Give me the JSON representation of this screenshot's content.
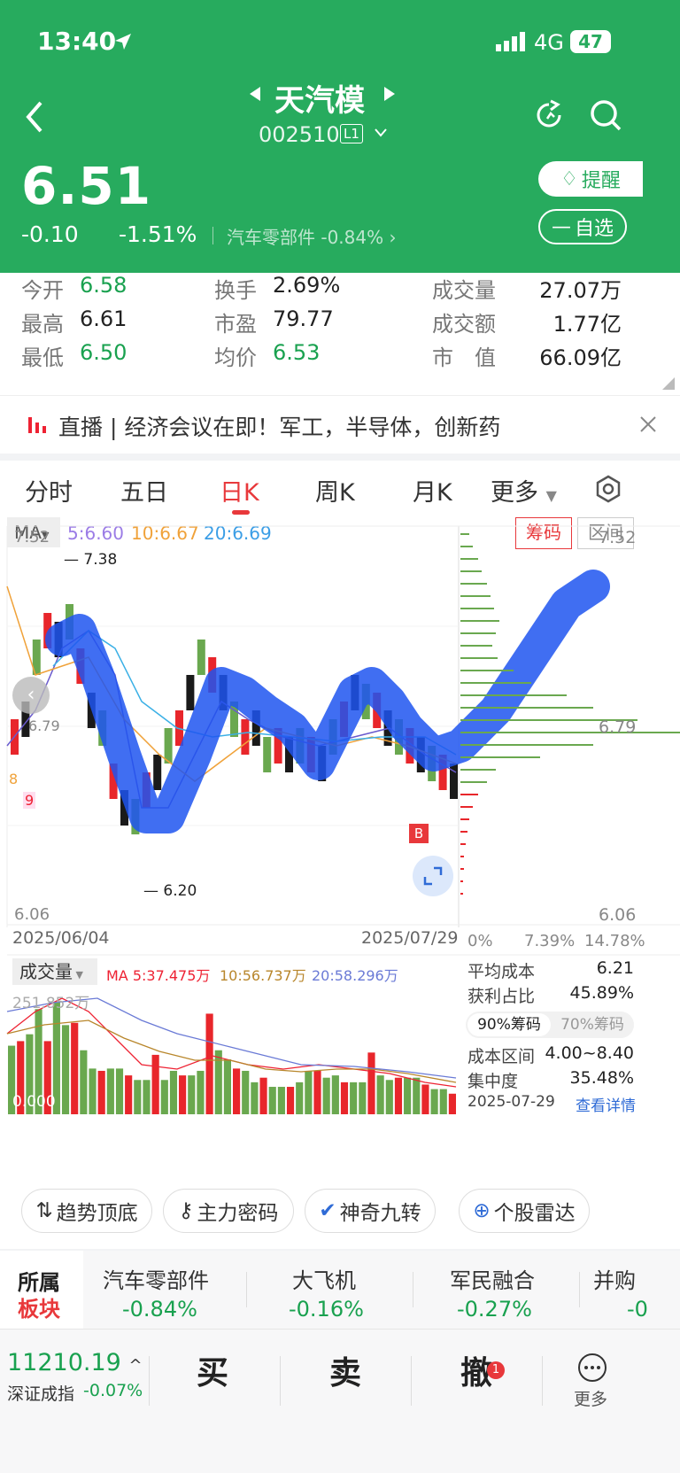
{
  "status": {
    "time": "13:40",
    "network": "4G",
    "battery": "47"
  },
  "stock": {
    "name": "天汽模",
    "code": "002510",
    "level": "L1",
    "price": "6.51",
    "change": "-0.10",
    "change_pct": "-1.51%",
    "sector": "汽车零部件",
    "sector_pct": "-0.84%",
    "remind": "提醒",
    "watch": "自选"
  },
  "stats": [
    {
      "label": "今开",
      "value": "6.58"
    },
    {
      "label": "换手",
      "value": "2.69%"
    },
    {
      "label": "成交量",
      "value": "27.07万"
    },
    {
      "label": "最高",
      "value": "6.61"
    },
    {
      "label": "市盈",
      "value": "79.77"
    },
    {
      "label": "成交额",
      "value": "1.77亿"
    },
    {
      "label": "最低",
      "value": "6.50"
    },
    {
      "label": "均价",
      "value": "6.53"
    },
    {
      "label": "市　值",
      "value": "66.09亿"
    }
  ],
  "news": {
    "tag": "直播",
    "text": "经济会议在即！军工，半导体，创新药"
  },
  "tabs": [
    "分时",
    "五日",
    "日K",
    "周K",
    "月K",
    "更多"
  ],
  "ma": {
    "label": "MA",
    "ma5": "5:6.60",
    "ma10": "10:6.67",
    "ma20": "20:6.69",
    "chips": "筹码",
    "range": "区间"
  },
  "kline": {
    "top": "7.52",
    "bottom": "6.06",
    "high_mark": "7.38",
    "low_mark": "6.20",
    "start_date": "2025/06/04",
    "end_date": "2025/07/29",
    "mid_right": "6.79",
    "b_marker": "B",
    "left_labels": [
      "6.79",
      "8",
      "9"
    ]
  },
  "chips_axis": {
    "top": "7.52",
    "mid": "6.79",
    "bottom": "6.06",
    "p0": "0%",
    "p1": "7.39%",
    "p2": "14.78%"
  },
  "volume": {
    "label": "成交量",
    "ma5": "MA 5:37.475万",
    "ma10": "10:56.737万",
    "ma20": "20:58.296万",
    "max": "251.852万",
    "zero": "0.000"
  },
  "chips": {
    "avg_cost_label": "平均成本",
    "avg_cost": "6.21",
    "profit_label": "获利占比",
    "profit": "45.89%",
    "tab90": "90%筹码",
    "tab70": "70%筹码",
    "range_label": "成本区间",
    "range": "4.00~8.40",
    "conc_label": "集中度",
    "conc": "35.48%",
    "date": "2025-07-29",
    "detail": "查看详情"
  },
  "tools": [
    "趋势顶底",
    "主力密码",
    "神奇九转",
    "个股雷达"
  ],
  "sector": {
    "title1": "所属",
    "title2": "板块",
    "items": [
      {
        "name": "汽车零部件",
        "pct": "-0.84%"
      },
      {
        "name": "大飞机",
        "pct": "-0.16%"
      },
      {
        "name": "军民融合",
        "pct": "-0.27%"
      },
      {
        "name": "并购",
        "pct": "-0"
      }
    ]
  },
  "bottom": {
    "index_value": "11210.19",
    "index_name": "深证成指",
    "index_pct": "-0.07%",
    "buy": "买",
    "sell": "卖",
    "cancel": "撤",
    "badge": "1",
    "more": "更多"
  },
  "chart_data": {
    "type": "bar",
    "title": "成交量",
    "x": [
      "2025/06/04",
      "2025/07/29"
    ],
    "series": [
      {
        "name": "成交量",
        "values": [
          150,
          160,
          175,
          230,
          160,
          245,
          195,
          200,
          140,
          100,
          95,
          100,
          100,
          85,
          75,
          75,
          130,
          75,
          95,
          85,
          85,
          95,
          220,
          140,
          120,
          100,
          95,
          70,
          80,
          60,
          60,
          60,
          70,
          95,
          95,
          80,
          85,
          70,
          70,
          70,
          135,
          85,
          75,
          80,
          80,
          80,
          65,
          55,
          55,
          45
        ]
      }
    ],
    "ylim": [
      0,
      251.852
    ]
  }
}
